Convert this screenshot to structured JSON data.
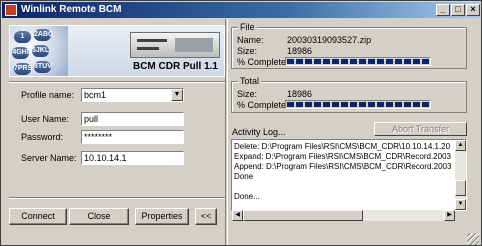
{
  "window": {
    "title": "Winlink Remote BCM",
    "controls": {
      "minimize": "_",
      "maximize": "□",
      "close": "×"
    }
  },
  "banner": {
    "title": "BCM CDR Pull 1.1",
    "keys": [
      "1",
      "2ABC",
      "4GHI",
      "5JKL",
      "7PRS",
      "8TUV"
    ]
  },
  "form": {
    "profile_label": "Profile name:",
    "profile_value": "bcm1",
    "user_label": "User Name:",
    "user_value": "pull",
    "password_label": "Password:",
    "password_value": "********",
    "server_label": "Server Name:",
    "server_value": "10.10.14.1"
  },
  "buttons": {
    "connect": "Connect",
    "close": "Close",
    "properties": "Properties",
    "collapse": "<<",
    "abort": "Abort Transfer"
  },
  "file_group": {
    "title": "File",
    "name_label": "Name:",
    "name_value": "20030319093527.zip",
    "size_label": "Size:",
    "size_value": "18986",
    "complete_label": "% Complete:",
    "complete_fraction": 1.0
  },
  "total_group": {
    "title": "Total",
    "size_label": "Size:",
    "size_value": "18986",
    "complete_label": "% Complete:",
    "complete_fraction": 1.0
  },
  "log": {
    "label": "Activity Log...",
    "lines": [
      "Delete: D:\\Program Files\\RSI\\CMS\\BCM_CDR\\10.10.14.1.20",
      "Expand: D:\\Program Files\\RSI\\CMS\\BCM_CDR\\Record.2003",
      "Append: D:\\Program Files\\RSI\\CMS\\BCM_CDR\\Record.2003",
      "Done",
      "",
      "Done..."
    ]
  }
}
